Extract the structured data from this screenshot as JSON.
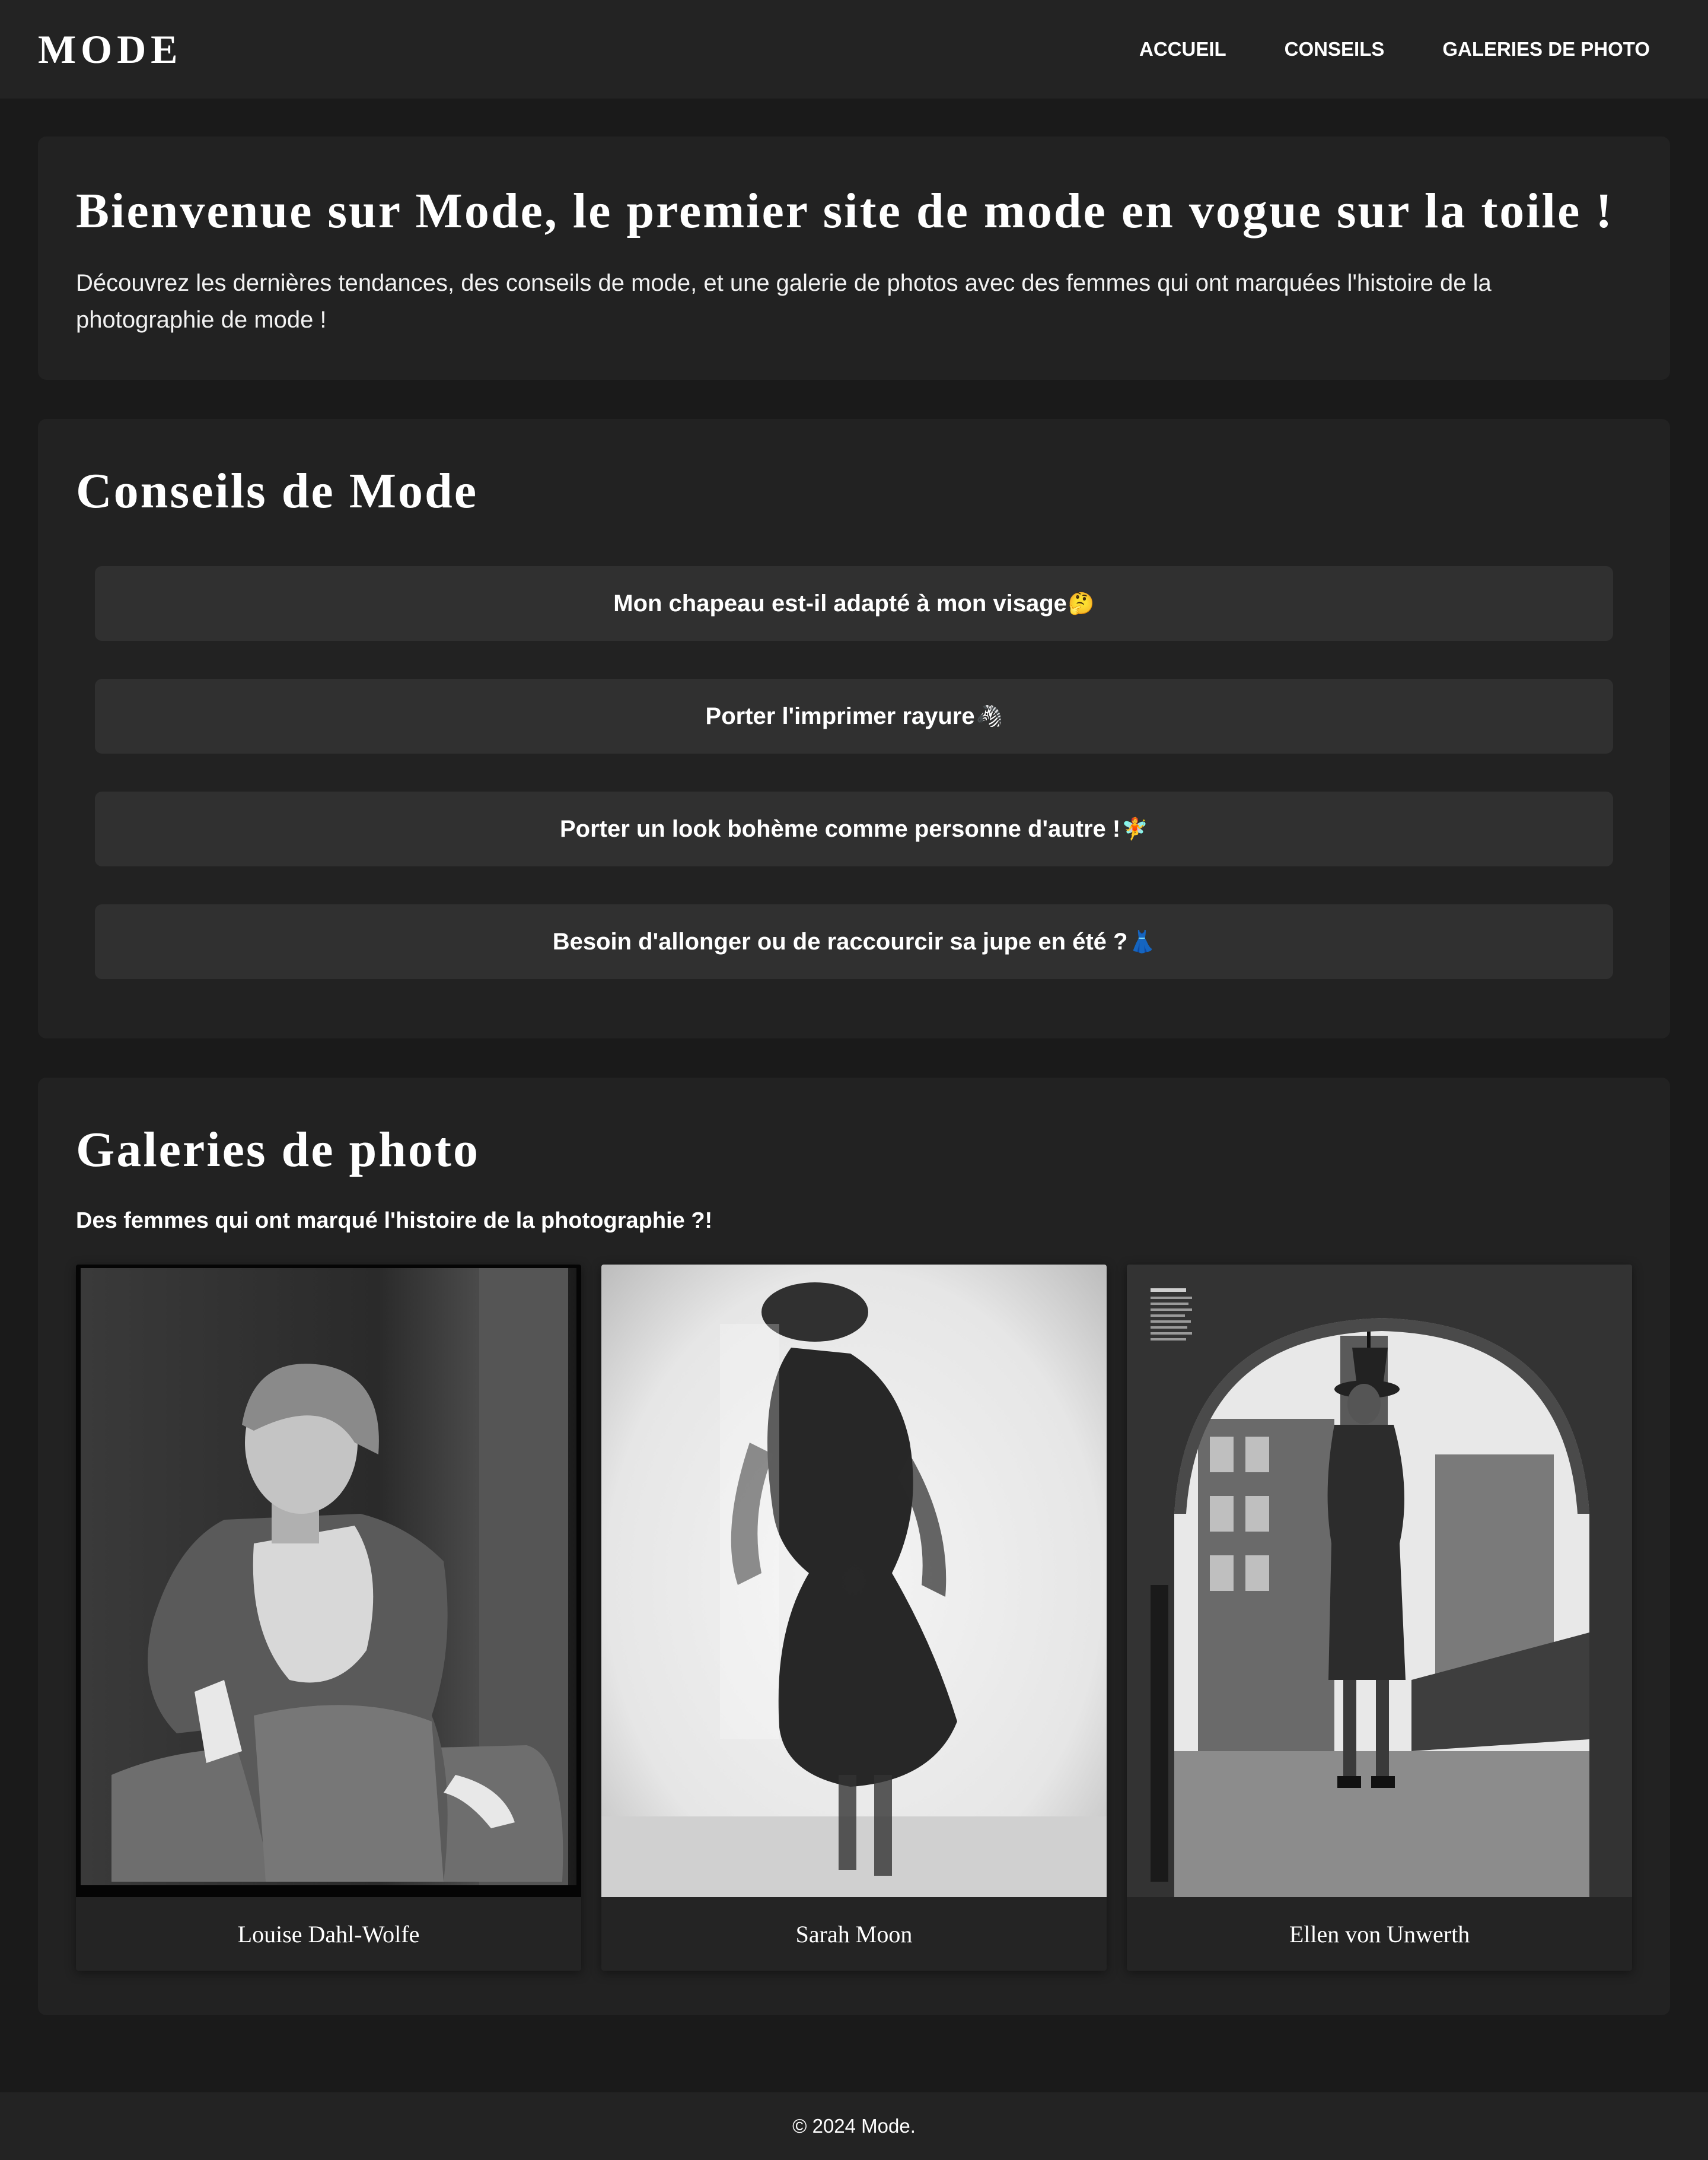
{
  "header": {
    "logo": "MODE",
    "nav": [
      "ACCUEIL",
      "CONSEILS",
      "GALERIES DE PHOTO"
    ]
  },
  "hero": {
    "title": "Bienvenue sur Mode, le premier site de mode en vogue sur la toile !",
    "text": "Découvrez les dernières tendances, des conseils de mode, et une galerie de photos avec des femmes qui ont marquées l'histoire de la photographie de mode !"
  },
  "tips": {
    "title": "Conseils de Mode",
    "items": [
      {
        "label": "Mon chapeau est-il adapté à mon visage",
        "emoji": "🤔"
      },
      {
        "label": "Porter l'imprimer rayure",
        "emoji": "🦓"
      },
      {
        "label": "Porter un look bohème comme personne d'autre !",
        "emoji": "🧚"
      },
      {
        "label": "Besoin d'allonger ou de raccourcir sa jupe en été ?",
        "emoji": "👗"
      }
    ]
  },
  "gallery": {
    "title": "Galeries de photo",
    "subtitle": "Des femmes qui ont marqué l'histoire de la photographie ?!",
    "photos": [
      {
        "caption": "Louise Dahl-Wolfe"
      },
      {
        "caption": "Sarah Moon"
      },
      {
        "caption": "Ellen von Unwerth"
      }
    ]
  },
  "footer": {
    "text": "© 2024 Mode."
  },
  "colors": {
    "page_background": "#1a1a1a",
    "header_background": "#232323",
    "card_background": "#222222",
    "tip_button": "#303030",
    "text": "#ffffff"
  }
}
